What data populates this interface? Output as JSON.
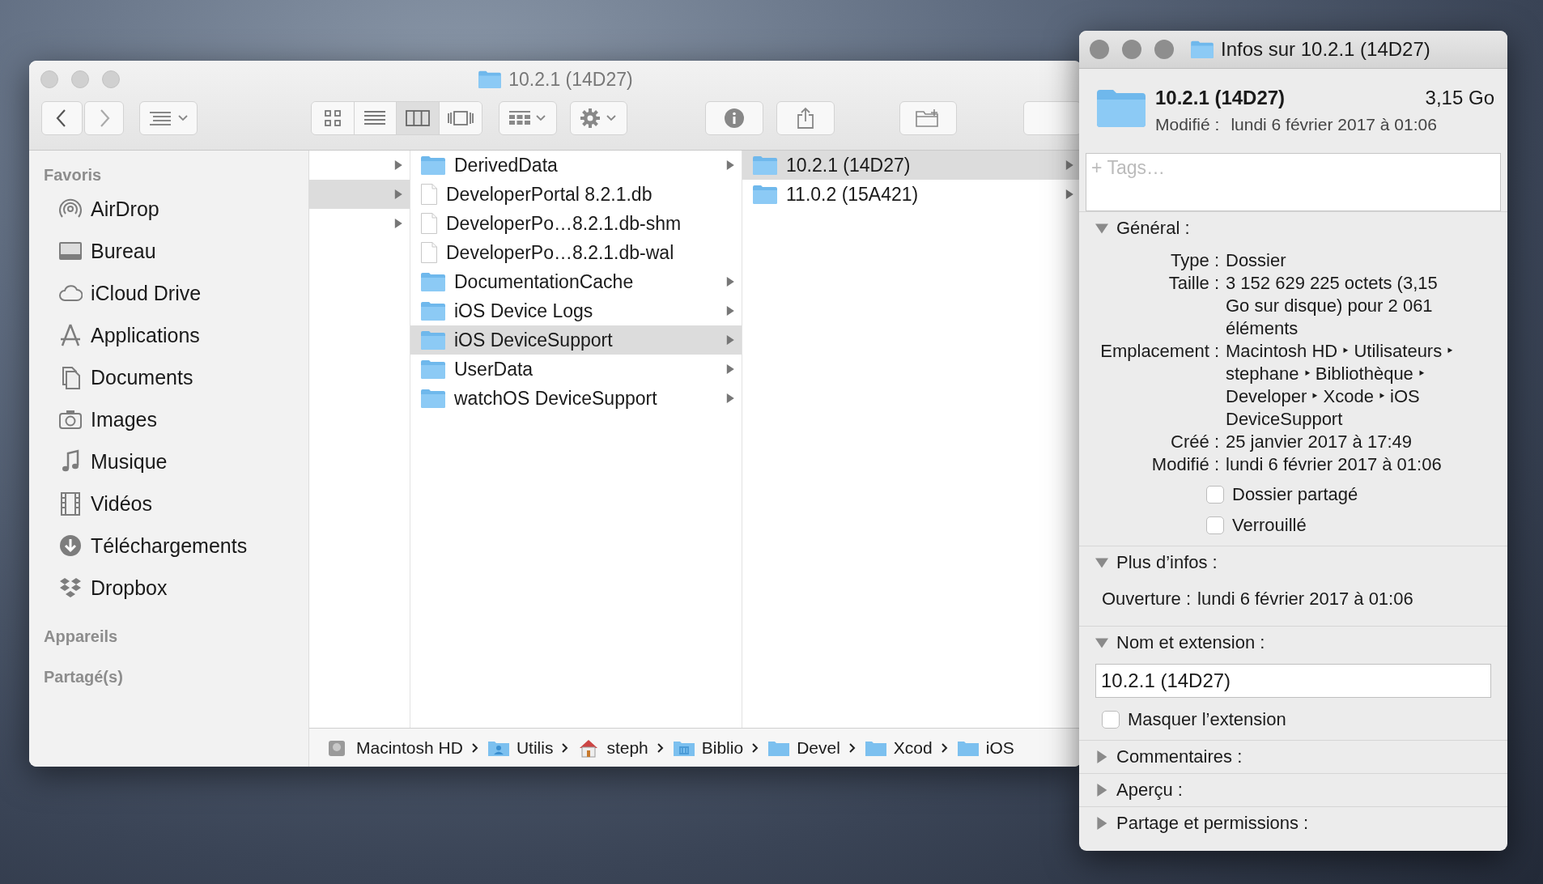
{
  "finder": {
    "title": "10.2.1 (14D27)",
    "view_modes": [
      {
        "kind": "icons",
        "selected": false
      },
      {
        "kind": "list",
        "selected": false
      },
      {
        "kind": "columns",
        "selected": true
      },
      {
        "kind": "coverflow",
        "selected": false
      }
    ],
    "sidebar": [
      {
        "title": "Favoris",
        "items": [
          {
            "kind": "airdrop",
            "label": "AirDrop"
          },
          {
            "kind": "desktop",
            "label": "Bureau"
          },
          {
            "kind": "cloud",
            "label": "iCloud Drive"
          },
          {
            "kind": "apps",
            "label": "Applications"
          },
          {
            "kind": "documents",
            "label": "Documents"
          },
          {
            "kind": "camera",
            "label": "Images"
          },
          {
            "kind": "music",
            "label": "Musique"
          },
          {
            "kind": "film",
            "label": "Vidéos"
          },
          {
            "kind": "download",
            "label": "Téléchargements"
          },
          {
            "kind": "dropbox",
            "label": "Dropbox"
          }
        ]
      },
      {
        "title": "Appareils"
      },
      {
        "title": "Partagé(s)"
      }
    ],
    "columns": [
      [
        {
          "has_children": true,
          "selected": false
        },
        {
          "has_children": true,
          "selected": true
        },
        {
          "has_children": true,
          "selected": false
        }
      ],
      [
        {
          "kind": "folder",
          "name": "DerivedData",
          "has_children": true,
          "selected": false
        },
        {
          "kind": "file",
          "name": "DeveloperPortal 8.2.1.db",
          "has_children": false,
          "selected": false
        },
        {
          "kind": "file",
          "name": "DeveloperPo…8.2.1.db-shm",
          "has_children": false,
          "selected": false
        },
        {
          "kind": "file",
          "name": "DeveloperPo…8.2.1.db-wal",
          "has_children": false,
          "selected": false
        },
        {
          "kind": "folder",
          "name": "DocumentationCache",
          "has_children": true,
          "selected": false
        },
        {
          "kind": "folder",
          "name": "iOS Device Logs",
          "has_children": true,
          "selected": false
        },
        {
          "kind": "folder",
          "name": "iOS DeviceSupport",
          "has_children": true,
          "selected": true
        },
        {
          "kind": "folder",
          "name": "UserData",
          "has_children": true,
          "selected": false
        },
        {
          "kind": "folder",
          "name": "watchOS DeviceSupport",
          "has_children": true,
          "selected": false
        }
      ],
      [
        {
          "kind": "folder",
          "name": "10.2.1 (14D27)",
          "has_children": true,
          "selected": true
        },
        {
          "kind": "folder",
          "name": "11.0.2 (15A421)",
          "has_children": true,
          "selected": false
        }
      ]
    ],
    "path_bar": [
      {
        "kind": "disk",
        "label": "Macintosh HD"
      },
      {
        "kind": "user-folder",
        "label": "Utilis"
      },
      {
        "kind": "home",
        "label": "steph"
      },
      {
        "kind": "library-folder",
        "label": "Biblio"
      },
      {
        "kind": "folder",
        "label": "Devel"
      },
      {
        "kind": "folder",
        "label": "Xcod"
      },
      {
        "kind": "folder",
        "label": "iOS"
      }
    ]
  },
  "info": {
    "title": "Infos sur 10.2.1 (14D27)",
    "name": "10.2.1 (14D27)",
    "size": "3,15 Go",
    "modified_label": "Modifié :",
    "modified": "lundi 6 février 2017 à 01:06",
    "tags_placeholder": "+ Tags…",
    "sections": [
      {
        "kind": "general",
        "title": "Général :",
        "expanded": true,
        "rows": [
          {
            "label": "Type :",
            "value": "Dossier"
          },
          {
            "label": "Taille :",
            "value": "3 152 629 225 octets (3,15 Go sur disque) pour 2 061 éléments"
          },
          {
            "label": "Emplacement :",
            "value": "Macintosh HD ‣ Utilisateurs ‣ stephane ‣ Bibliothèque ‣ Developer ‣ Xcode ‣ iOS DeviceSupport"
          },
          {
            "label": "Créé :",
            "value": "25 janvier 2017 à 17:49"
          },
          {
            "label": "Modifié :",
            "value": "lundi 6 février 2017 à 01:06"
          }
        ],
        "checkboxes": [
          {
            "label": "Dossier partagé",
            "checked": false
          },
          {
            "label": "Verrouillé",
            "checked": false
          }
        ]
      },
      {
        "kind": "more",
        "title": "Plus d’infos :",
        "expanded": true,
        "rows": [
          {
            "label": "Ouverture :",
            "value": "lundi 6 février 2017 à 01:06"
          }
        ]
      },
      {
        "kind": "name",
        "title": "Nom et extension :",
        "expanded": true,
        "value": "10.2.1 (14D27)",
        "checkboxes": [
          {
            "label": "Masquer l’extension",
            "checked": false
          }
        ]
      },
      {
        "title": "Commentaires :",
        "expanded": false
      },
      {
        "title": "Aperçu :",
        "expanded": false
      },
      {
        "title": "Partage et permissions :",
        "expanded": false
      }
    ]
  }
}
